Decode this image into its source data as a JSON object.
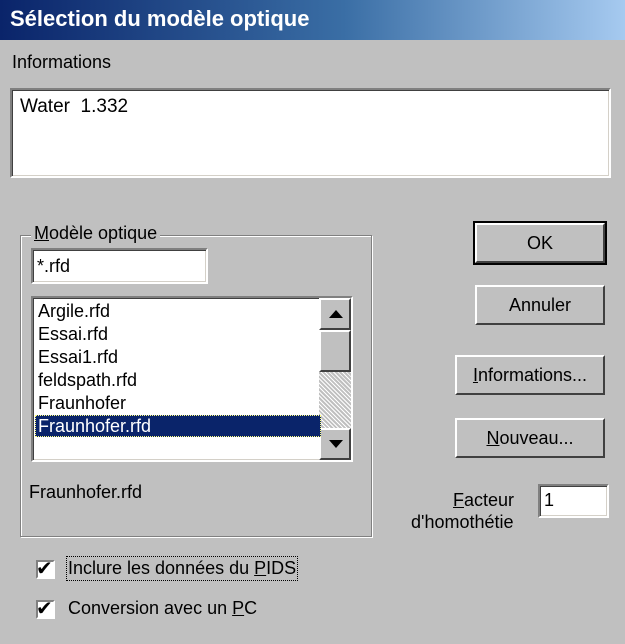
{
  "window": {
    "title": "Sélection du modèle optique"
  },
  "info": {
    "label": "Informations",
    "text": "Water  1.332"
  },
  "group": {
    "legend_mnemonic": "M",
    "legend_rest": "odèle optique",
    "filter_value": "*.rfd",
    "list_items": [
      "Argile.rfd",
      "Essai.rfd",
      "Essai1.rfd",
      "feldspath.rfd",
      "Fraunhofer",
      "Fraunhofer.rfd"
    ],
    "selected_index": 5,
    "selected_label": "Fraunhofer.rfd"
  },
  "buttons": {
    "ok": "OK",
    "cancel": "Annuler",
    "info_mnemonic": "I",
    "info_rest": "nformations...",
    "new_mnemonic": "N",
    "new_rest": "ouveau..."
  },
  "factor": {
    "label1_mnemonic": "F",
    "label1_rest": "acteur",
    "label2": "d'homothétie",
    "value": "1"
  },
  "checks": {
    "pids_prefix": "Inclure les données du ",
    "pids_mnemonic": "P",
    "pids_suffix": "IDS",
    "pids_checked": true,
    "pc_prefix": "Conversion avec un ",
    "pc_mnemonic": "P",
    "pc_suffix": "C",
    "pc_checked": true
  }
}
